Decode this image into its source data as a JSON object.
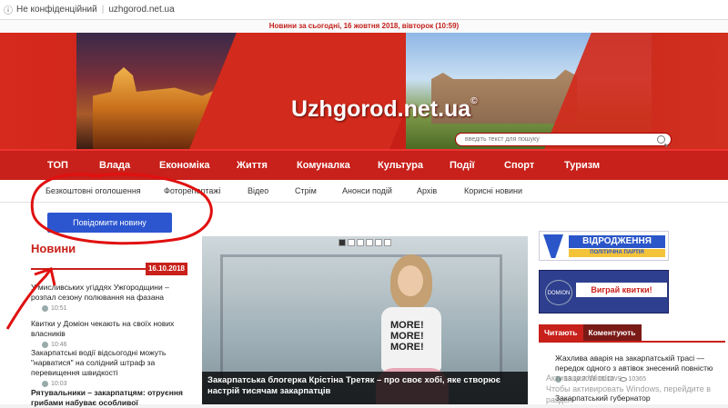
{
  "browser": {
    "security_label": "Не конфіденційний",
    "url": "uzhgorod.net.ua"
  },
  "topline": {
    "text": "Новини за сьогодні, 16 жовтня 2018, вівторок (10:59)"
  },
  "header": {
    "site_title": "Uzhgorod.net.ua",
    "copyright_mark": "©",
    "search_placeholder": "введіть текст для пошуку"
  },
  "main_nav": [
    "ТОП",
    "Влада",
    "Економіка",
    "Життя",
    "Комуналка",
    "Культура",
    "Події",
    "Спорт",
    "Туризм"
  ],
  "sub_nav": [
    "Безкоштовні оголошення",
    "Фоторепортажі",
    "Відео",
    "Стрім",
    "Анонси подій",
    "Архів",
    "Корисні новини"
  ],
  "left": {
    "report_button": "Повідомити новину",
    "news_heading": "Новини",
    "date": "16.10.2018",
    "items": [
      {
        "title": "У мисливських угіддях Ужгородщини – розпал сезону полювання на фазана",
        "time": "10:51"
      },
      {
        "title": "Квитки у Домiон чекають на своїх нових власників",
        "time": "10:46"
      },
      {
        "title": "Закарпатські водії відсьогодні можуть \"нарватися\" на солідний штраф за перевищення швидкості",
        "time": "10:03"
      },
      {
        "title": "Рятувальники – закарпатцям: отруєння грибами набуває особливої",
        "time": ""
      }
    ]
  },
  "slider": {
    "caption": "Закарпатська блогерка Крістіна Третяк – про своє хобі, яке створює настрій тисячам закарпатців",
    "shirt_text": "MORE! MORE! MORE!",
    "dot_count": 6
  },
  "right": {
    "ad1_name": "ВІДРОДЖЕННЯ",
    "ad1_sub": "ПОЛІТИЧНА ПАРТІЯ",
    "ad2_logo": "DOMION",
    "ad2_cta": "Виграй квитки!",
    "tabs": [
      "Читають",
      "Коментують"
    ],
    "items": [
      {
        "title": "Жахлива аварія на закарпатській трасі — передок одного з автівок знесений повністю",
        "date": "13.10.2018 15:12",
        "views": "10365"
      },
      {
        "title": "Закарпатський губернатор",
        "date": "",
        "views": ""
      }
    ]
  },
  "watermark": {
    "line1": "Активация Windows",
    "line2": "Чтобы активировать Windows, перейдите в раздел"
  },
  "colors": {
    "brand_red": "#c8201a",
    "button_blue": "#2b56d0"
  }
}
